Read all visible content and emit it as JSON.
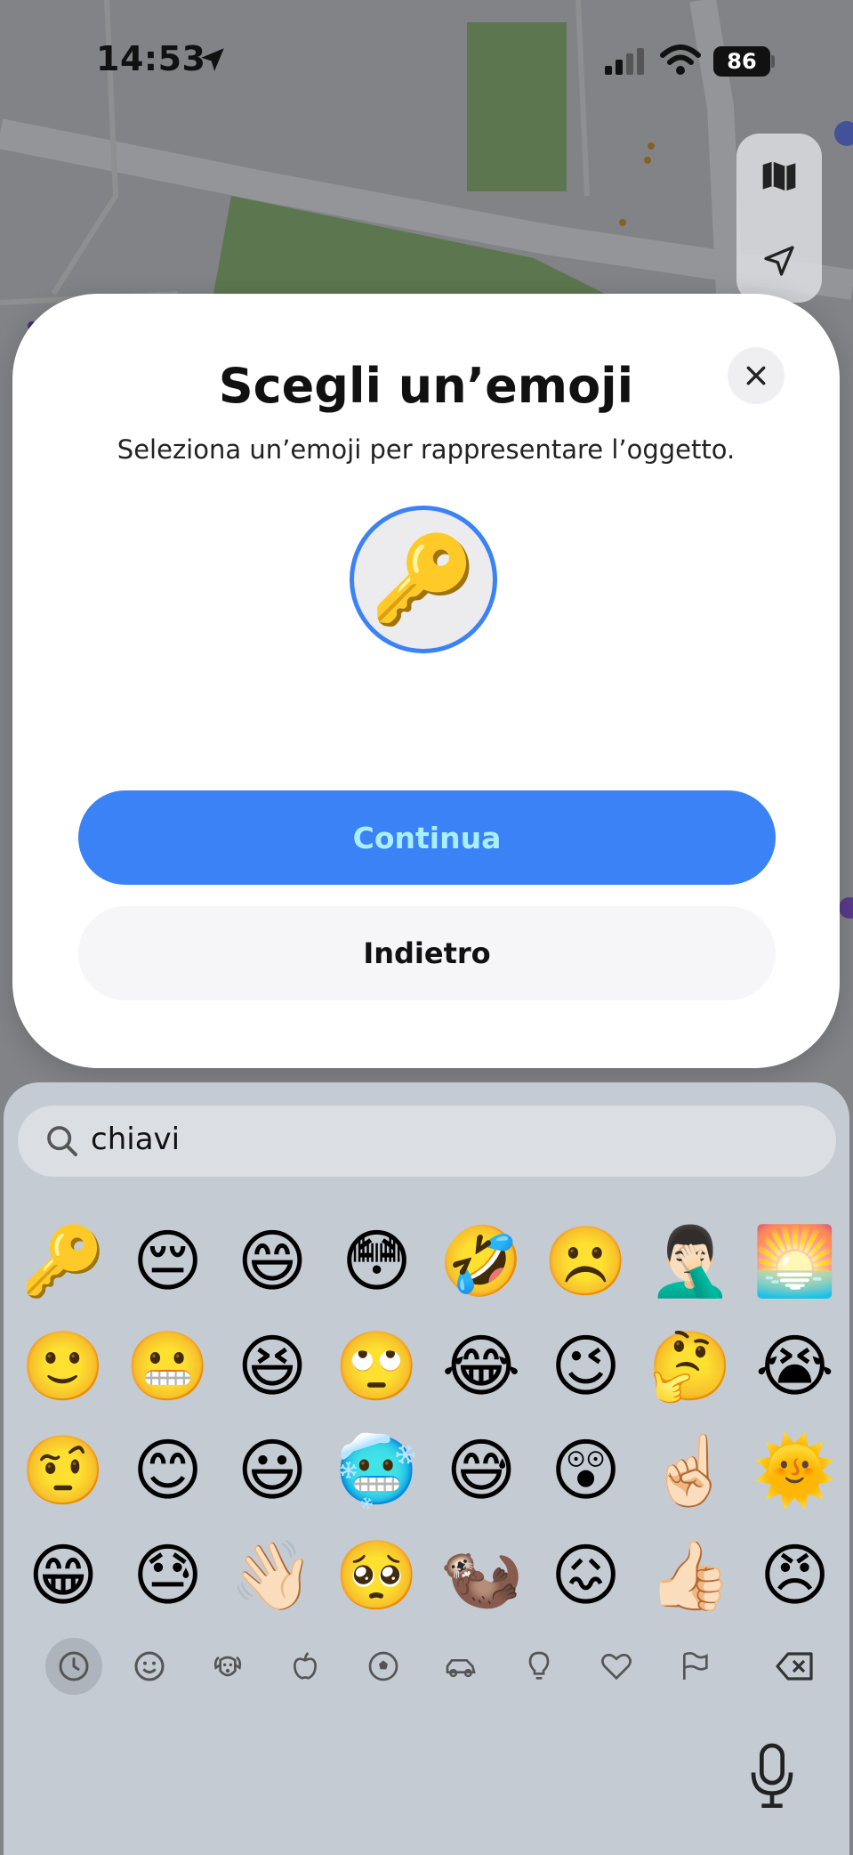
{
  "status_bar": {
    "time": "14:53",
    "battery": "86",
    "icons": [
      "location-arrow-icon",
      "cellular-signal-icon",
      "wifi-icon",
      "battery-icon"
    ]
  },
  "map_controls": {
    "icons": [
      "map-icon",
      "location-arrow-icon"
    ]
  },
  "dialog": {
    "title": "Scegli un’emoji",
    "subtitle": "Seleziona un’emoji per rappresentare l’oggetto.",
    "selected_emoji": "🔑",
    "accent_color": "#3b82f6",
    "primary_button": "Continua",
    "secondary_button": "Indietro",
    "close_icon": "close-icon"
  },
  "keyboard": {
    "search": {
      "value": "chiavi",
      "icon": "search-icon"
    },
    "emojis": [
      "🔑",
      "😔",
      "😄",
      "😳",
      "🤣",
      "☹️",
      "🤦🏻‍♂️",
      "🌅",
      "🙂",
      "😬",
      "😆",
      "🙄",
      "😂",
      "😉",
      "🤔",
      "😭",
      "🤨",
      "😊",
      "😃",
      "🥶",
      "😅",
      "😲",
      "☝🏻",
      "🌞",
      "😁",
      "😓",
      "👋🏻",
      "🥺",
      "🦦",
      "😖",
      "👍🏻",
      "😠"
    ],
    "categories": [
      {
        "name": "recent",
        "icon": "clock-icon",
        "selected": true
      },
      {
        "name": "smileys",
        "icon": "smiley-icon",
        "selected": false
      },
      {
        "name": "animals",
        "icon": "dog-icon",
        "selected": false
      },
      {
        "name": "food",
        "icon": "apple-icon",
        "selected": false
      },
      {
        "name": "activity",
        "icon": "soccer-ball-icon",
        "selected": false
      },
      {
        "name": "travel",
        "icon": "car-icon",
        "selected": false
      },
      {
        "name": "objects",
        "icon": "lightbulb-icon",
        "selected": false
      },
      {
        "name": "symbols",
        "icon": "heart-icon",
        "selected": false
      },
      {
        "name": "flags",
        "icon": "flag-icon",
        "selected": false
      }
    ],
    "delete_icon": "delete-backspace-icon",
    "mic_icon": "microphone-icon"
  }
}
